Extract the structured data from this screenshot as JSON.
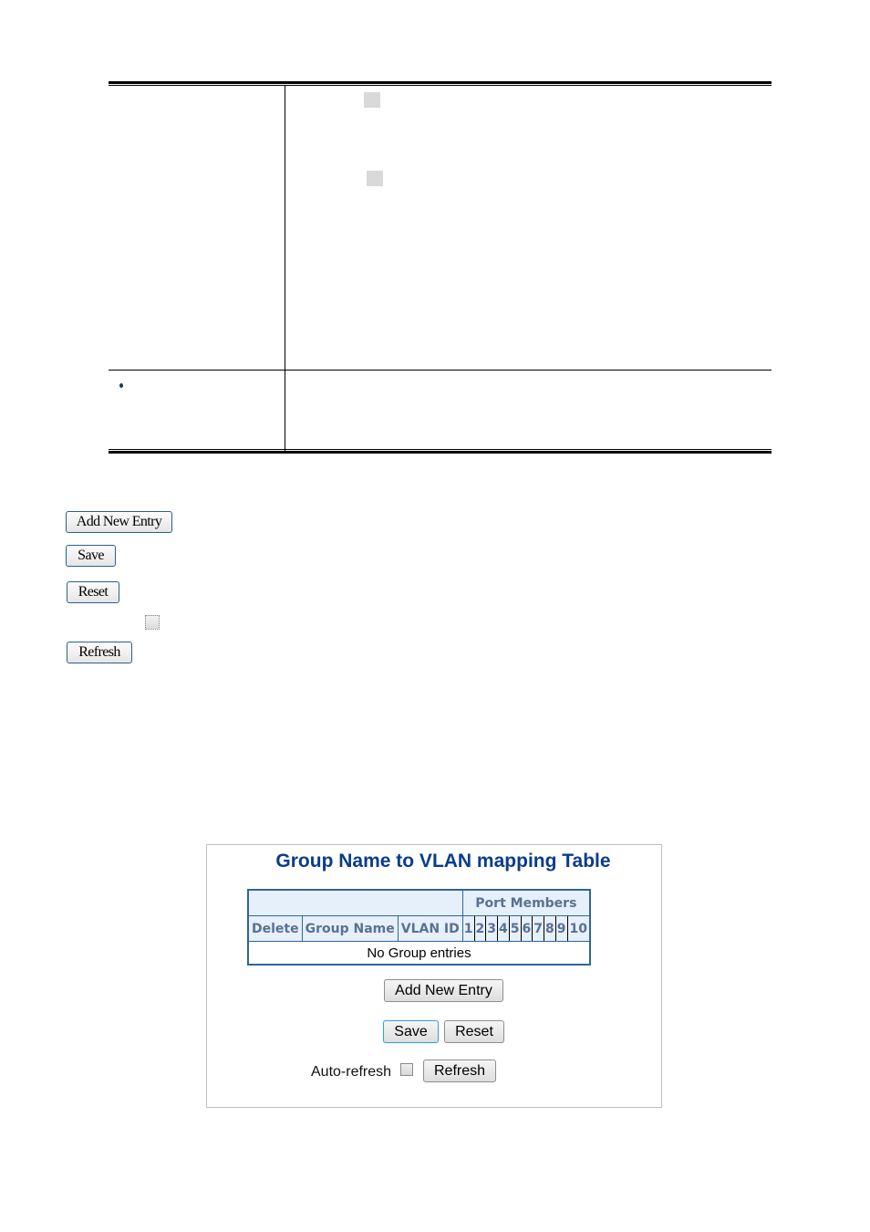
{
  "document": {
    "param_table": {
      "rows": [
        {
          "parameter": "",
          "description": ""
        },
        {
          "parameter": "",
          "description": "",
          "has_bullet": true
        }
      ]
    },
    "buttons_reference": {
      "add_new_entry": "Add New Entry",
      "save": "Save",
      "reset": "Reset",
      "auto_refresh_checked": false,
      "refresh": "Refresh"
    }
  },
  "screenshot": {
    "title": "Group Name to VLAN mapping Table",
    "table": {
      "group_header": "Port Members",
      "columns": [
        "Delete",
        "Group Name",
        "VLAN ID"
      ],
      "ports": [
        "1",
        "2",
        "3",
        "4",
        "5",
        "6",
        "7",
        "8",
        "9",
        "10"
      ],
      "empty_message": "No Group entries"
    },
    "buttons": {
      "add_new_entry": "Add New Entry",
      "save": "Save",
      "reset": "Reset",
      "refresh": "Refresh"
    },
    "auto_refresh": {
      "label": "Auto-refresh",
      "checked": false
    }
  }
}
